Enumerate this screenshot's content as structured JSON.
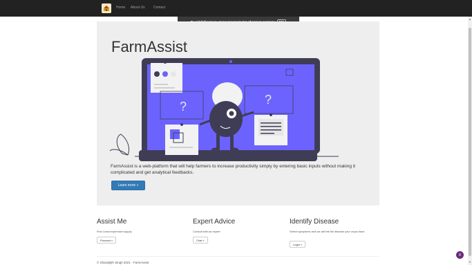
{
  "navbar": {
    "logo_icon": "farm-logo-icon",
    "links": [
      "Home",
      "About Us",
      "Contact"
    ]
  },
  "fullscreen_toast": {
    "message": "To exit full screen, move mouse to top of screen or press",
    "key": "F11"
  },
  "hero": {
    "title": "FarmAssist",
    "description": "FarmAssist is a web-platform that will help farmers to increase productivity simply by entering basic inputs without making it complicated and get analytical feedbacks.",
    "button": "Learn more »",
    "question_mark": "?"
  },
  "features": [
    {
      "title": "Assist Me",
      "text": "Find Least expensive supply",
      "button": "Proceed »"
    },
    {
      "title": "Expert Advice",
      "text": "Consult with an expert",
      "button": "Chat »"
    },
    {
      "title": "Identify Disease",
      "text": "Select symptoms and we will tell the disease your crops have",
      "button": "Login »"
    }
  ],
  "footer": {
    "text": "© Sharabjith Singh 2021 - FarmAssist"
  },
  "floating_badge": "8",
  "colors": {
    "navbar": "#222222",
    "accent": "#6c63ff",
    "primary_button": "#337ab7",
    "dark_figure": "#3f3d56",
    "jumbotron": "#eeeeee"
  }
}
